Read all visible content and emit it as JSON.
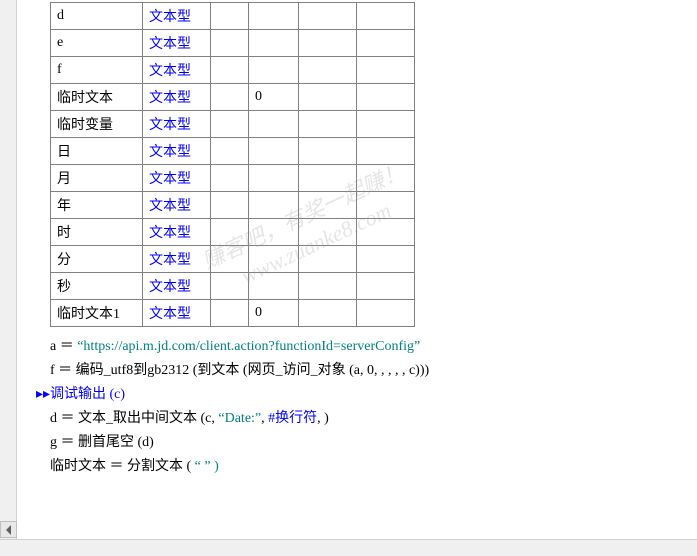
{
  "table": {
    "rows": [
      {
        "name": "d",
        "type": "文本型",
        "val": ""
      },
      {
        "name": "e",
        "type": "文本型",
        "val": ""
      },
      {
        "name": "f",
        "type": "文本型",
        "val": ""
      },
      {
        "name": "临时文本",
        "type": "文本型",
        "val": "0"
      },
      {
        "name": "临时变量",
        "type": "文本型",
        "val": ""
      },
      {
        "name": "日",
        "type": "文本型",
        "val": ""
      },
      {
        "name": "月",
        "type": "文本型",
        "val": ""
      },
      {
        "name": "年",
        "type": "文本型",
        "val": ""
      },
      {
        "name": "时",
        "type": "文本型",
        "val": ""
      },
      {
        "name": "分",
        "type": "文本型",
        "val": ""
      },
      {
        "name": "秒",
        "type": "文本型",
        "val": ""
      },
      {
        "name": "临时文本1",
        "type": "文本型",
        "val": "0"
      }
    ]
  },
  "code": {
    "line1": {
      "var": "a",
      "eq": " ＝ ",
      "str": "“https://api.m.jd.com/client.action?functionId=serverConfig”"
    },
    "line2": {
      "var": "f",
      "eq": " ＝ ",
      "fn1": "编码_utf8到gb2312",
      "p1": " (",
      "fn2": "到文本",
      "p2": " (",
      "fn3": "网页_访问_对象",
      "args": " (a, 0, , , , , c)",
      "close": "))"
    },
    "line3": {
      "marker": "▸▸",
      "text": "调试输出 (c)"
    },
    "line4": {
      "var": "d",
      "eq": " ＝ ",
      "fn": "文本_取出中间文本",
      "p1": " (c, ",
      "str": "“Date:”",
      "sep": ", ",
      "const": "#换行符",
      "close": ", )"
    },
    "line5": {
      "var": "g",
      "eq": " ＝ ",
      "fn": "删首尾空",
      "args": " (d)"
    },
    "line6": {
      "var": "临时文本",
      "eq": " ＝ ",
      "fn": "分割文本",
      "p1": " (",
      "rest": "  “ ”  )"
    }
  },
  "watermark": {
    "line1": "赚客吧，有奖一起赚！",
    "line2": "www.zuanke8.com"
  }
}
